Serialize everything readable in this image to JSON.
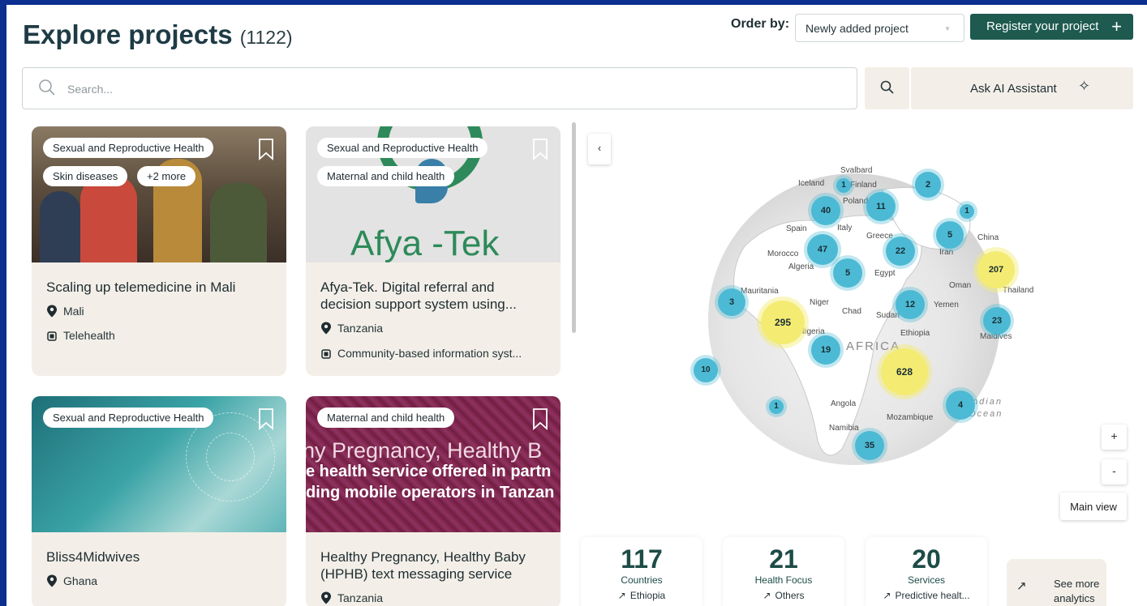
{
  "header": {
    "title": "Explore projects",
    "count": "(1122)",
    "order_label": "Order by:",
    "order_value": "Newly added project",
    "register_label": "Register your project"
  },
  "search": {
    "placeholder": "Search...",
    "ai_label": "Ask AI Assistant"
  },
  "cards": [
    {
      "tags_row1": [
        "Sexual and Reproductive Health"
      ],
      "tags_row2": [
        "Skin diseases",
        "+2 more"
      ],
      "title": "Scaling up telemedicine in Mali",
      "country": "Mali",
      "service": "Telehealth",
      "image_colors": [
        "#6b5a48",
        "#c94a3c"
      ]
    },
    {
      "tags_row1": [
        "Sexual and Reproductive Health"
      ],
      "tags_row2": [
        "Maternal and child health"
      ],
      "title": "Afya-Tek. Digital referral and decision support system using...",
      "country": "Tanzania",
      "service": "Community-based information syst...",
      "logo_text": "Afya -Tek",
      "image_colors": [
        "#e4e4e4",
        "#2e8a5a"
      ]
    },
    {
      "tags_row1": [
        "Sexual and Reproductive Health"
      ],
      "tags_row2": [],
      "title": "Bliss4Midwives",
      "country": "Ghana",
      "service": "",
      "image_colors": [
        "#2b8a8f",
        "#a9d8d6"
      ]
    },
    {
      "tags_row1": [
        "Maternal and child health"
      ],
      "tags_row2": [],
      "title": "Healthy Pregnancy, Healthy Baby (HPHB) text messaging service",
      "country": "Tanzania",
      "service": "",
      "overlay_lines": [
        "ny Pregnancy, Healthy B",
        "e health service offered in partn",
        "ding mobile operators in Tanzan"
      ],
      "image_colors": [
        "#7a2046",
        "#a8486e"
      ]
    }
  ],
  "map": {
    "labels": [
      {
        "t": "Svalbard"
      },
      {
        "t": "Iceland"
      },
      {
        "t": "Finland"
      },
      {
        "t": "Poland"
      },
      {
        "t": "Spain"
      },
      {
        "t": "Italy"
      },
      {
        "t": "Greece"
      },
      {
        "t": "Morocco"
      },
      {
        "t": "Algeria"
      },
      {
        "t": "Egypt"
      },
      {
        "t": "Iran"
      },
      {
        "t": "China"
      },
      {
        "t": "Oman"
      },
      {
        "t": "Thailand"
      },
      {
        "t": "Mauritania"
      },
      {
        "t": "Niger"
      },
      {
        "t": "Chad"
      },
      {
        "t": "Sudan"
      },
      {
        "t": "Yemen"
      },
      {
        "t": "Nigeria"
      },
      {
        "t": "Ethiopia"
      },
      {
        "t": "Maldives"
      },
      {
        "t": "AFRICA"
      },
      {
        "t": "Angola"
      },
      {
        "t": "Mozambique"
      },
      {
        "t": "Namibia"
      },
      {
        "t": "Indian"
      },
      {
        "t": "Ocean"
      }
    ],
    "clusters": [
      {
        "n": "1"
      },
      {
        "n": "2"
      },
      {
        "n": "40"
      },
      {
        "n": "11"
      },
      {
        "n": "1"
      },
      {
        "n": "5"
      },
      {
        "n": "47"
      },
      {
        "n": "22"
      },
      {
        "n": "5"
      },
      {
        "n": "207"
      },
      {
        "n": "3"
      },
      {
        "n": "295"
      },
      {
        "n": "12"
      },
      {
        "n": "23"
      },
      {
        "n": "19"
      },
      {
        "n": "10"
      },
      {
        "n": "628"
      },
      {
        "n": "1"
      },
      {
        "n": "4"
      },
      {
        "n": "35"
      }
    ],
    "collapse_label": "‹",
    "zoom_in": "+",
    "zoom_out": "-",
    "main_view": "Main view"
  },
  "stats": [
    {
      "num": "117",
      "label": "Countries",
      "sub": "Ethiopia"
    },
    {
      "num": "21",
      "label": "Health Focus",
      "sub": "Others"
    },
    {
      "num": "20",
      "label": "Services",
      "sub": "Predictive healt..."
    }
  ],
  "analytics_label": "See more analytics",
  "colors": {
    "brand": "#1e5a4f",
    "beige": "#f3efe8",
    "cluster_blue": "#4cbad4",
    "cluster_yellow": "#f4ec72"
  }
}
